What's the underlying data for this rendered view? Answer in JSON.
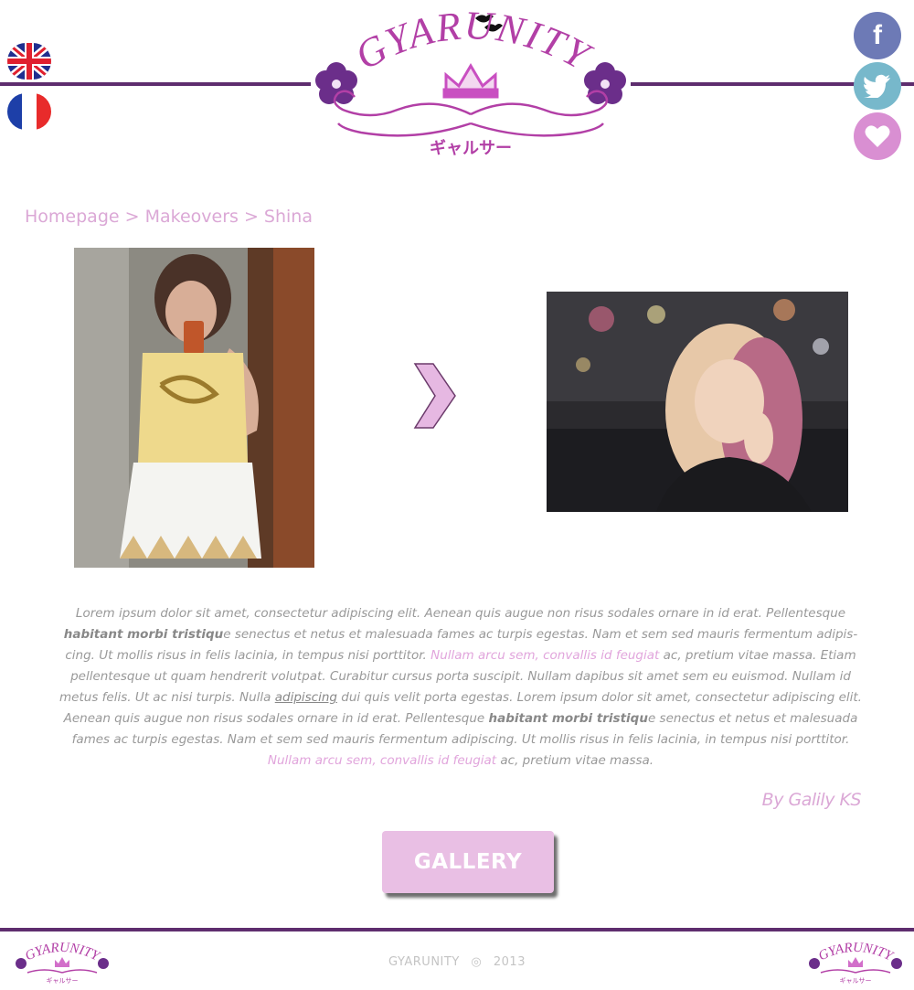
{
  "header": {
    "logo_text": "GYARUNITY",
    "logo_sub": "ギャルサー",
    "languages": [
      {
        "name": "English",
        "icon": "uk-flag-icon"
      },
      {
        "name": "Français",
        "icon": "france-flag-icon"
      }
    ],
    "social": [
      {
        "icon": "facebook-icon",
        "color": "#6d7ab6"
      },
      {
        "icon": "twitter-icon",
        "color": "#77b8cb"
      },
      {
        "icon": "heart-icon",
        "color": "#d98fd2"
      }
    ]
  },
  "breadcrumb": {
    "items": [
      "Homepage",
      "Makeovers",
      "Shina"
    ],
    "separator": " > "
  },
  "article": {
    "s1": "Lorem ipsum dolor sit amet, consectetur adipiscing elit. Aenean quis augue non risus sodales ornare in id erat. Pellentesque ",
    "b1": "habitant morbi tristiqu",
    "s2": "e senectus et netus et malesuada fames ac turpis egestas. Nam et sem sed mauris fermentum adipis-cing. Ut mollis risus in felis lacinia, in tempus nisi porttitor. ",
    "l1": "Nullam arcu sem, convallis id feugiat",
    "s3": " ac, pretium vitae massa. Etiam pellentesque ut quam hendrerit volutpat. Curabitur cursus porta suscipit. Nullam dapibus sit amet sem eu euismod. Nullam id metus felis. Ut ac nisi turpis. Nulla ",
    "u1": "adipiscing",
    "s4": " dui quis velit porta egestas. Lorem ipsum dolor sit amet, consectetur adipiscing elit. Aenean quis augue non risus sodales ornare in id erat. Pellentesque ",
    "b2": "habitant morbi tristiqu",
    "s5": "e senectus et netus et malesuada fames ac turpis egestas. Nam et sem sed mauris fermentum adipiscing. Ut mollis risus in felis lacinia, in tempus nisi porttitor. ",
    "l2": "Nullam arcu sem, convallis id feugiat",
    "s6": " ac, pretium vitae massa.",
    "author": "By Galily KS"
  },
  "gallery_button": "GALLERY",
  "footer": {
    "brand": "GYARUNITY",
    "year": "2013",
    "logo_text": "GYARUNITY",
    "logo_sub": "ギャルサー"
  },
  "colors": {
    "accent": "#dba8d6",
    "rule": "#5e2d6e",
    "button": "#e9bfe4",
    "link": "#e1a5dc"
  }
}
